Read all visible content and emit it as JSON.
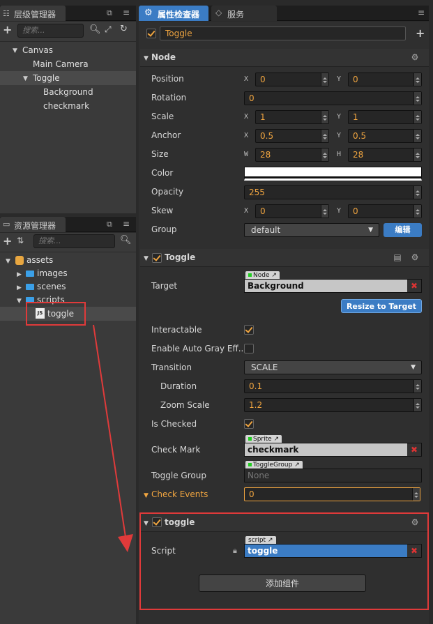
{
  "hierarchy": {
    "title": "层级管理器",
    "search_placeholder": "搜索...",
    "items": [
      "Canvas",
      "Main Camera",
      "Toggle",
      "Background",
      "checkmark"
    ]
  },
  "assets": {
    "title": "资源管理器",
    "search_placeholder": "搜索...",
    "items": [
      "assets",
      "images",
      "scenes",
      "scripts",
      "toggle"
    ]
  },
  "inspector": {
    "tab_active": "属性检查器",
    "tab_other": "服务",
    "node_name": "Toggle",
    "node": {
      "title": "Node",
      "position_label": "Position",
      "position_x": "0",
      "position_y": "0",
      "rotation_label": "Rotation",
      "rotation": "0",
      "scale_label": "Scale",
      "scale_x": "1",
      "scale_y": "1",
      "anchor_label": "Anchor",
      "anchor_x": "0.5",
      "anchor_y": "0.5",
      "size_label": "Size",
      "size_w": "28",
      "size_h": "28",
      "color_label": "Color",
      "color_value": "#ffffff",
      "opacity_label": "Opacity",
      "opacity": "255",
      "skew_label": "Skew",
      "skew_x": "0",
      "skew_y": "0",
      "group_label": "Group",
      "group_value": "default",
      "edit_button": "编辑",
      "axis_x": "X",
      "axis_y": "Y",
      "axis_w": "W",
      "axis_h": "H"
    },
    "toggle": {
      "title": "Toggle",
      "target_label": "Target",
      "target_type": "Node",
      "target_value": "Background",
      "resize_button": "Resize to Target",
      "interactable_label": "Interactable",
      "auto_gray_label": "Enable Auto Gray Eff...",
      "transition_label": "Transition",
      "transition_value": "SCALE",
      "duration_label": "Duration",
      "duration": "0.1",
      "zoom_label": "Zoom Scale",
      "zoom": "1.2",
      "checked_label": "Is Checked",
      "checkmark_label": "Check Mark",
      "checkmark_type": "Sprite",
      "checkmark_value": "checkmark",
      "group_label": "Toggle Group",
      "group_type": "ToggleGroup",
      "group_value": "None",
      "events_label": "Check Events",
      "events_count": "0"
    },
    "script": {
      "title": "toggle",
      "script_label": "Script",
      "script_type": "script",
      "script_value": "toggle"
    },
    "add_component": "添加组件"
  },
  "colors": {
    "accent": "#f0a540",
    "highlight": "#e03a3a",
    "blue": "#3b7cc4"
  }
}
